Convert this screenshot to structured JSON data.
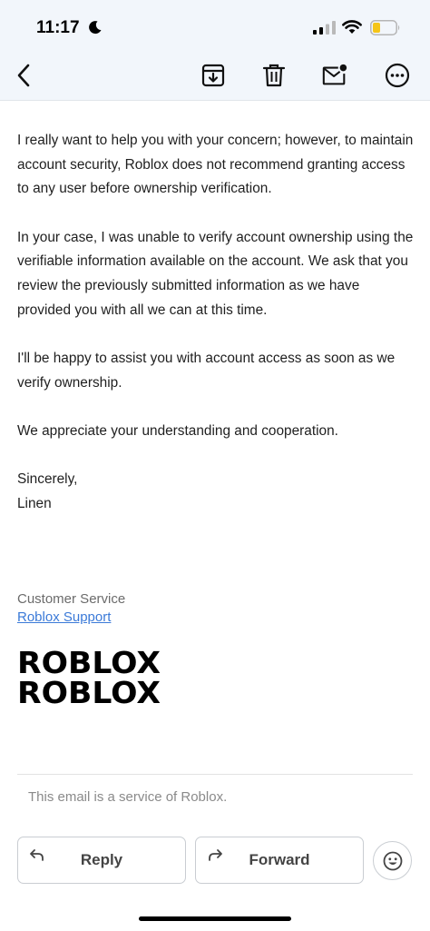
{
  "status_bar": {
    "time": "11:17"
  },
  "toolbar": {
    "back": "back-arrow-icon",
    "archive": "archive-icon",
    "delete": "trash-icon",
    "mark_unread": "mail-unread-icon",
    "more": "more-horizontal-icon"
  },
  "email": {
    "paragraphs": [
      "I really want to help you with your concern; however, to maintain account security, Roblox does not recommend granting access to any user before ownership verification.",
      "In your case, I was unable to verify account ownership using the verifiable information available on the account. We ask that you review the previously submitted information as we have provided you with all we can at this time.",
      "I'll be happy to assist you with account access as soon as we verify ownership.",
      "We appreciate your understanding and cooperation."
    ],
    "closing": "Sincerely,",
    "signer": "Linen",
    "signature_role": "Customer Service",
    "signature_link": "Roblox Support",
    "logo_text": "ROBLOX",
    "footer_note": "This email is a service of Roblox."
  },
  "actions": {
    "reply": "Reply",
    "forward": "Forward"
  },
  "colors": {
    "toolbar_bg": "#f2f6fb",
    "link": "#3b7ad8",
    "battery": "#f5c518"
  }
}
